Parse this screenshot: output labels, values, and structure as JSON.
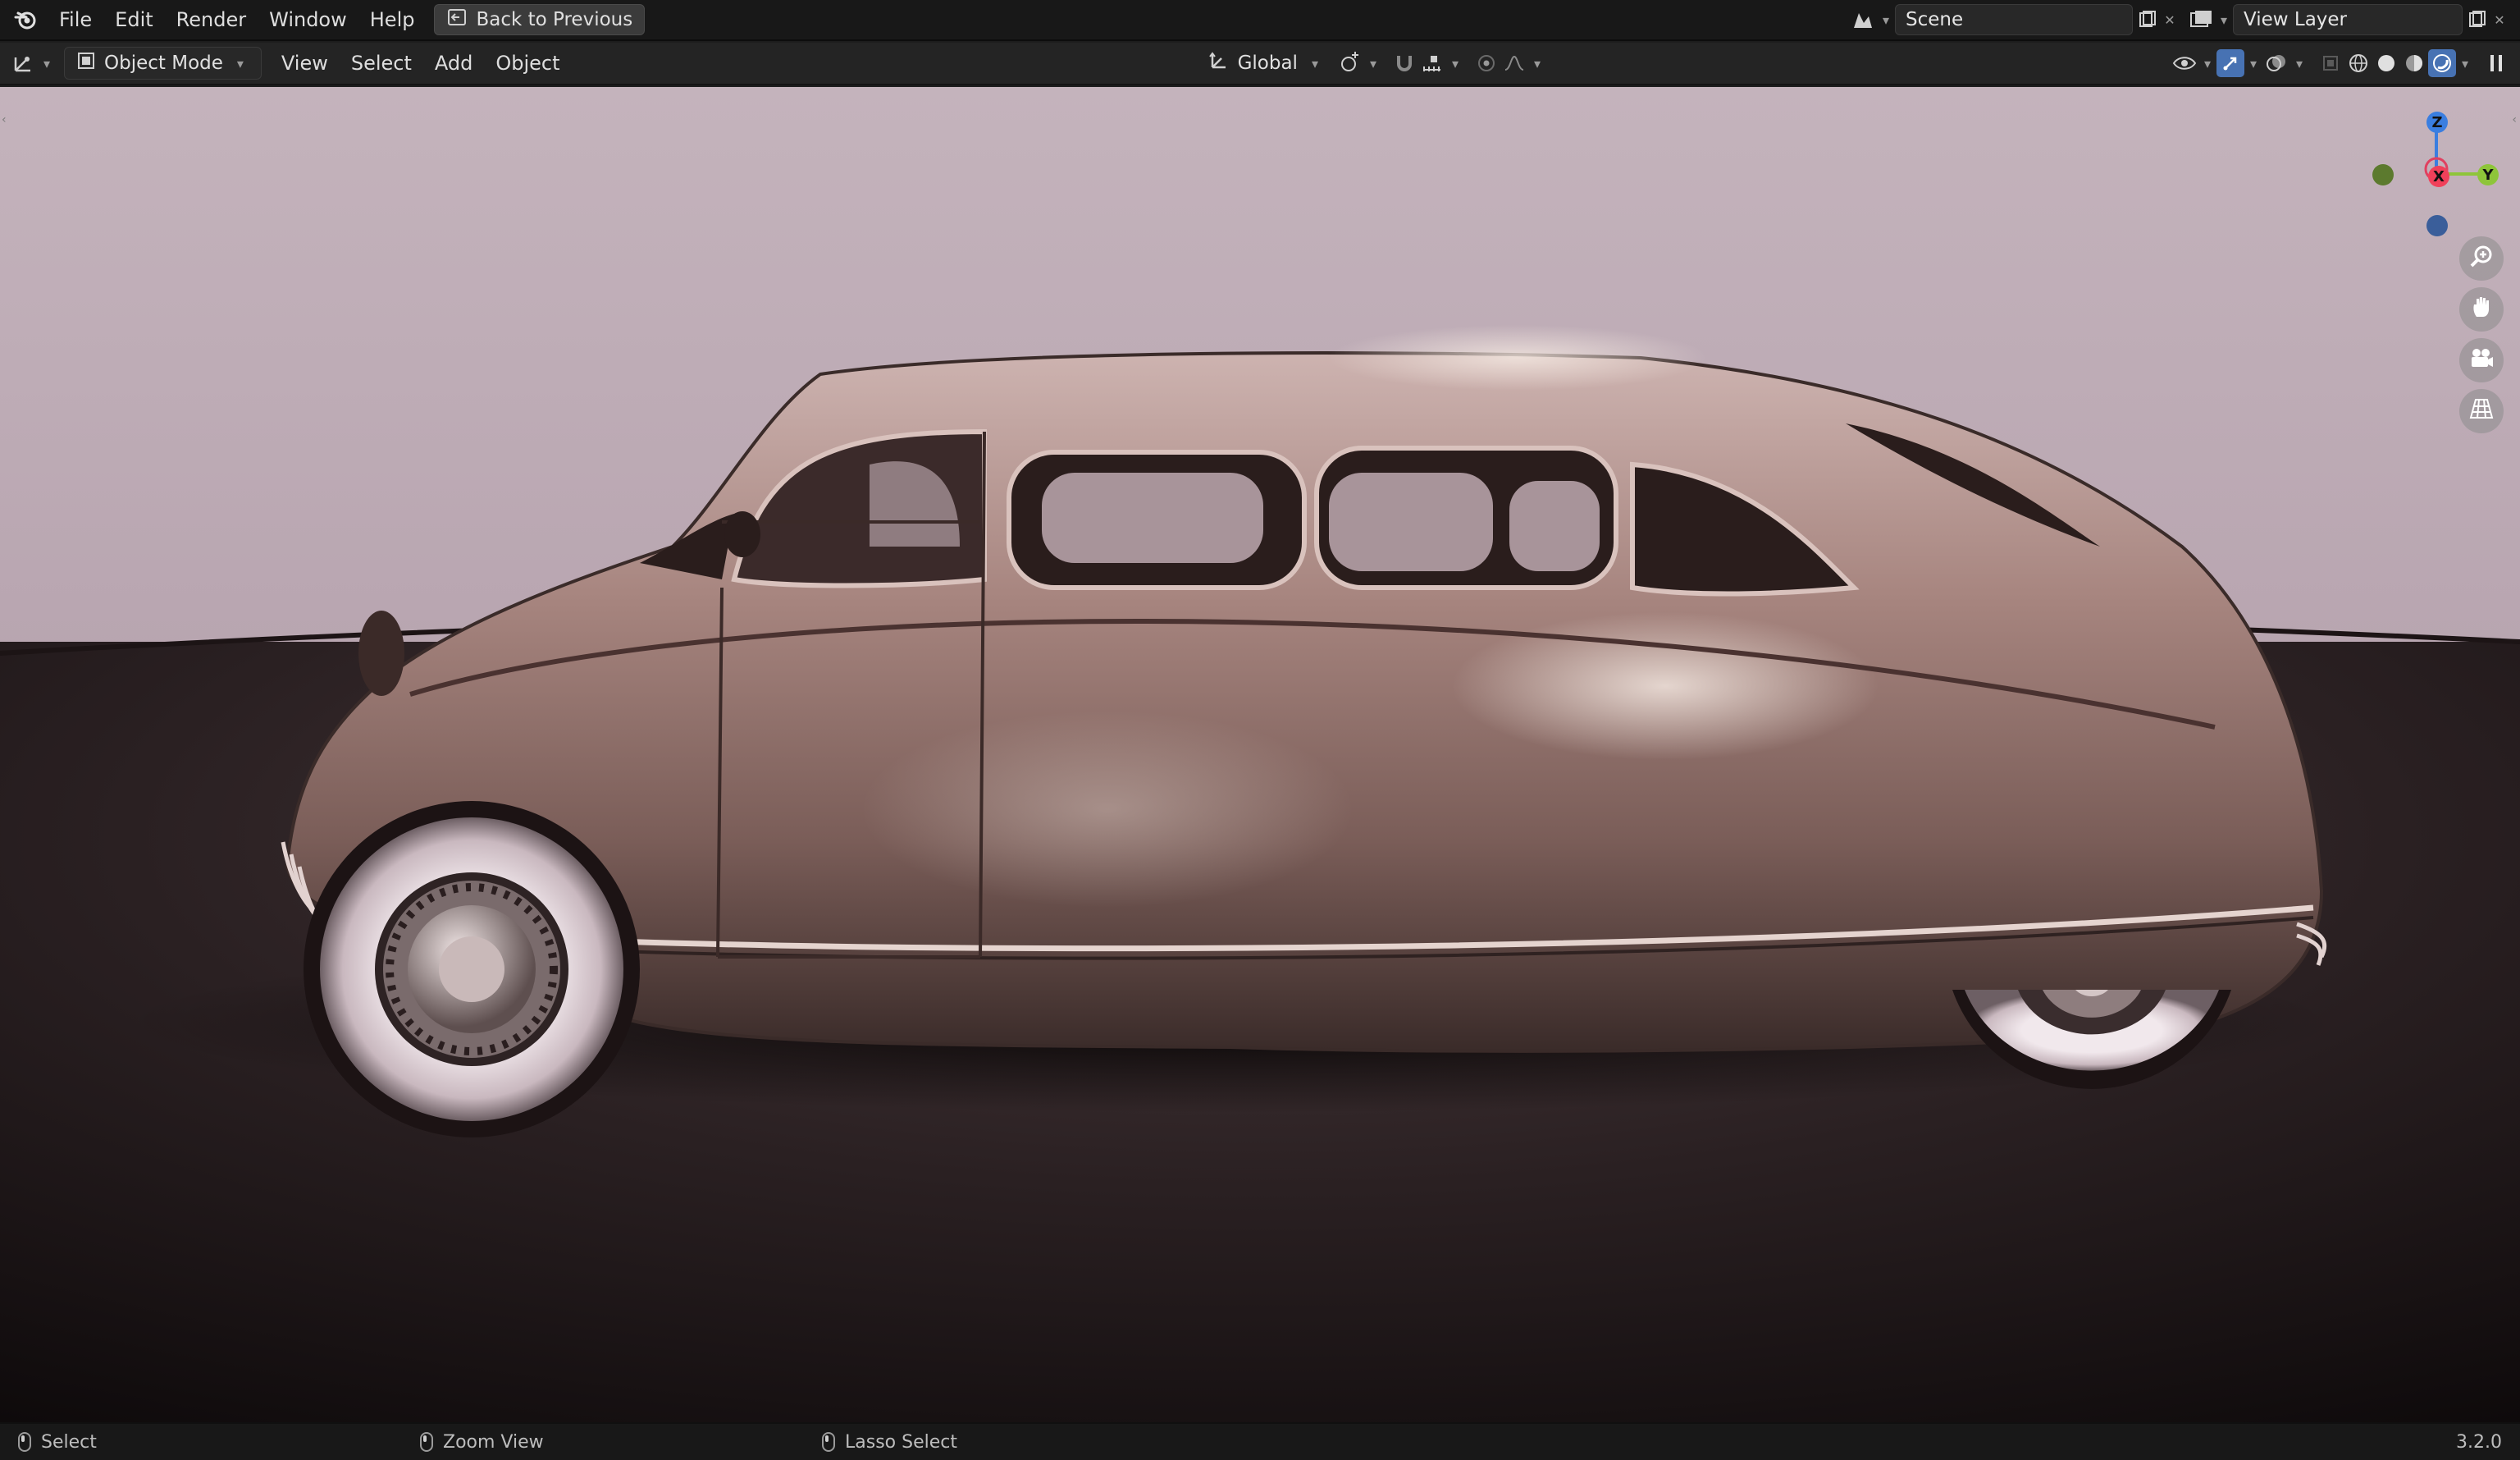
{
  "topbar": {
    "menus": [
      "File",
      "Edit",
      "Render",
      "Window",
      "Help"
    ],
    "back_button": "Back to Previous",
    "scene": "Scene",
    "view_layer": "View Layer"
  },
  "header": {
    "mode": "Object Mode",
    "menus": [
      "View",
      "Select",
      "Add",
      "Object"
    ],
    "transform_orientation": "Global"
  },
  "gizmo": {
    "z": "Z",
    "y": "Y",
    "x": "X"
  },
  "status": {
    "left": "Select",
    "middle": "Zoom View",
    "right": "Lasso Select",
    "version": "3.2.0"
  },
  "colors": {
    "accent": "#4772b3",
    "axis_x": "#f0405a",
    "axis_y": "#8ec53a",
    "axis_z": "#3a7ee0"
  }
}
